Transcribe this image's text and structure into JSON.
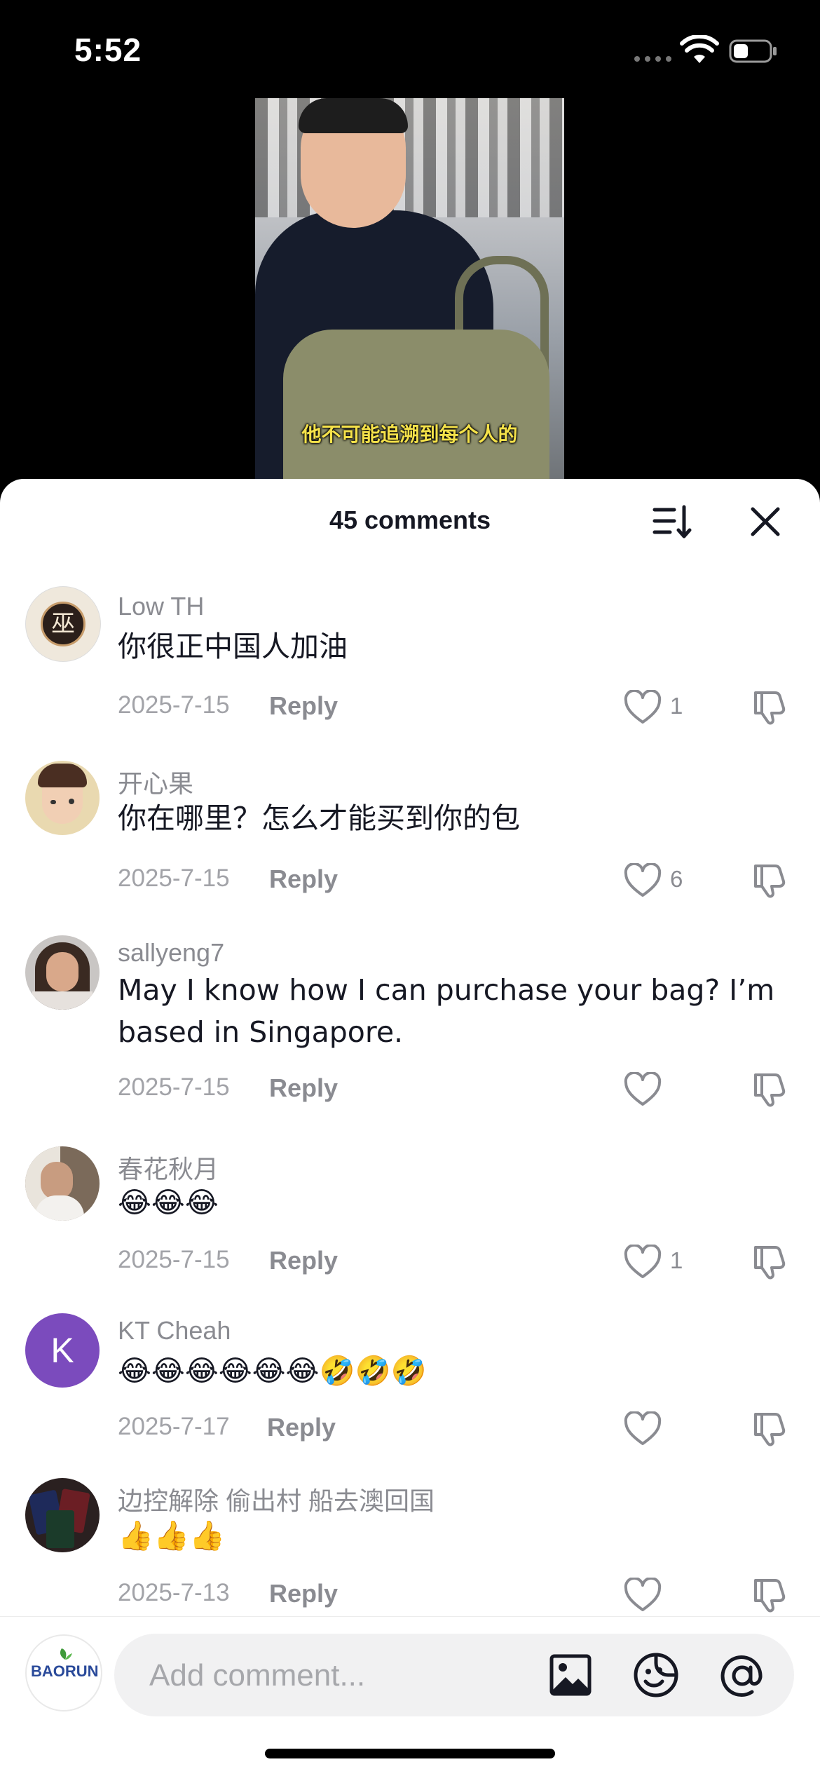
{
  "status": {
    "time": "5:52"
  },
  "video": {
    "caption": "他不可能追溯到每个人的"
  },
  "sheet": {
    "title": "45 comments"
  },
  "comments": [
    {
      "user": "Low TH",
      "text": "你很正中国人加油",
      "date": "2025-7-15",
      "reply": "Reply",
      "likes": "1",
      "avatar_char": "巫"
    },
    {
      "user": "开心果",
      "text": "你在哪里？怎么才能买到你的包",
      "date": "2025-7-15",
      "reply": "Reply",
      "likes": "6"
    },
    {
      "user": "sallyeng7",
      "text": "May I know how I can purchase your bag? I’m based in Singapore.",
      "date": "2025-7-15",
      "reply": "Reply",
      "likes": ""
    },
    {
      "user": "春花秋月",
      "text": "😂😂😂",
      "date": "2025-7-15",
      "reply": "Reply",
      "likes": "1"
    },
    {
      "user": "KT Cheah",
      "text": "😂😂😂😂😂😂🤣🤣🤣",
      "date": "2025-7-17",
      "reply": "Reply",
      "likes": "",
      "avatar_char": "K",
      "avatar_color": "#7b4bbd"
    },
    {
      "user": "边控解除 偷出村 船去澳回国",
      "text": "👍👍👍",
      "date": "2025-7-13",
      "reply": "Reply",
      "likes": ""
    }
  ],
  "composer": {
    "placeholder": "Add comment...",
    "avatar_text": "BAORUN"
  },
  "icons": {
    "sort": "sort-icon",
    "close": "close-icon",
    "like": "heart-outline-icon",
    "dislike": "thumbs-down-icon",
    "image": "image-icon",
    "emoji": "emoji-icon",
    "mention": "at-icon"
  }
}
